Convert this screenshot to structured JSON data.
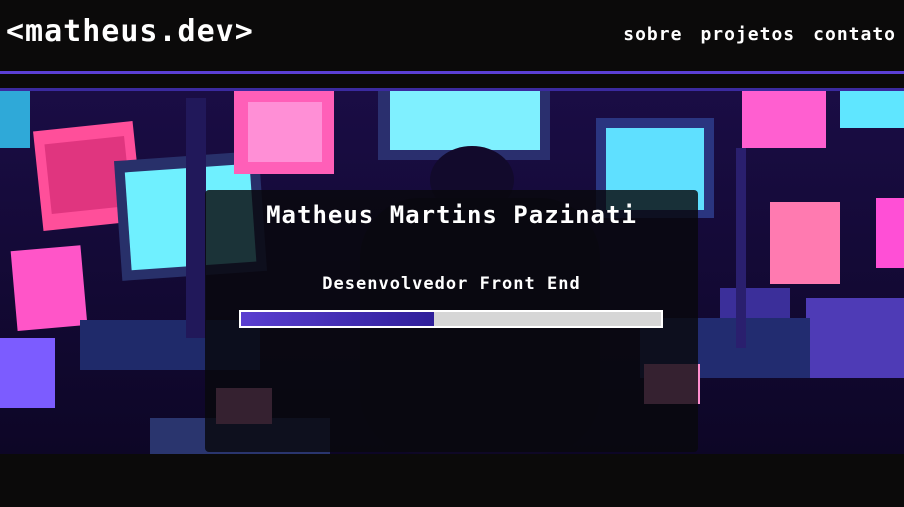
{
  "header": {
    "logo": "<matheus.dev>",
    "nav": [
      {
        "label": "sobre"
      },
      {
        "label": "projetos"
      },
      {
        "label": "contato"
      }
    ]
  },
  "hero": {
    "name": "Matheus Martins Pazinati",
    "role": "Desenvolvedor Front End",
    "progress_percent": 46
  },
  "colors": {
    "accent": "#5b3fd6",
    "background": "#0b0a0a"
  }
}
